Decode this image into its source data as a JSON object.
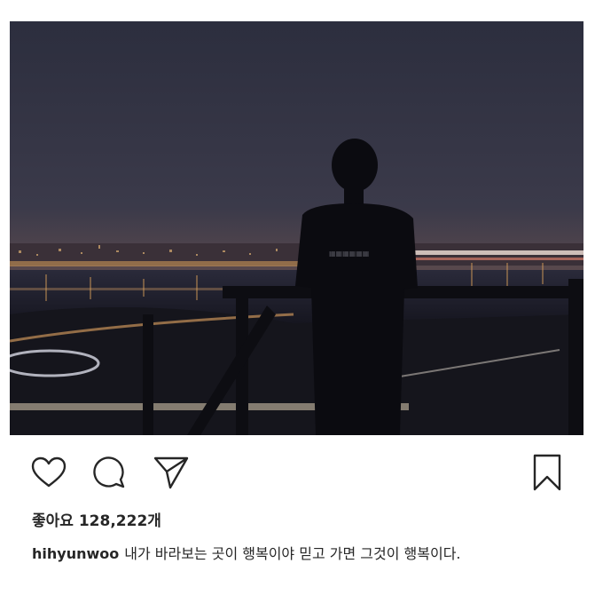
{
  "post": {
    "image_alt": "Silhouette of a person standing at a railing overlooking a city river at night",
    "likes_label": "좋아요 128,222개",
    "username": "hihyunwoo",
    "caption": "내가 바라보는 곳이 행복이야 믿고 가면 그것이 행복이다."
  },
  "actions": {
    "like_icon": "heart-outline-icon",
    "comment_icon": "speech-bubble-icon",
    "share_icon": "paper-plane-icon",
    "save_icon": "bookmark-outline-icon"
  },
  "colors": {
    "text": "#262626",
    "background": "#ffffff",
    "sky_top": "#2a2c3c",
    "sky_horizon": "#6a4b45"
  }
}
